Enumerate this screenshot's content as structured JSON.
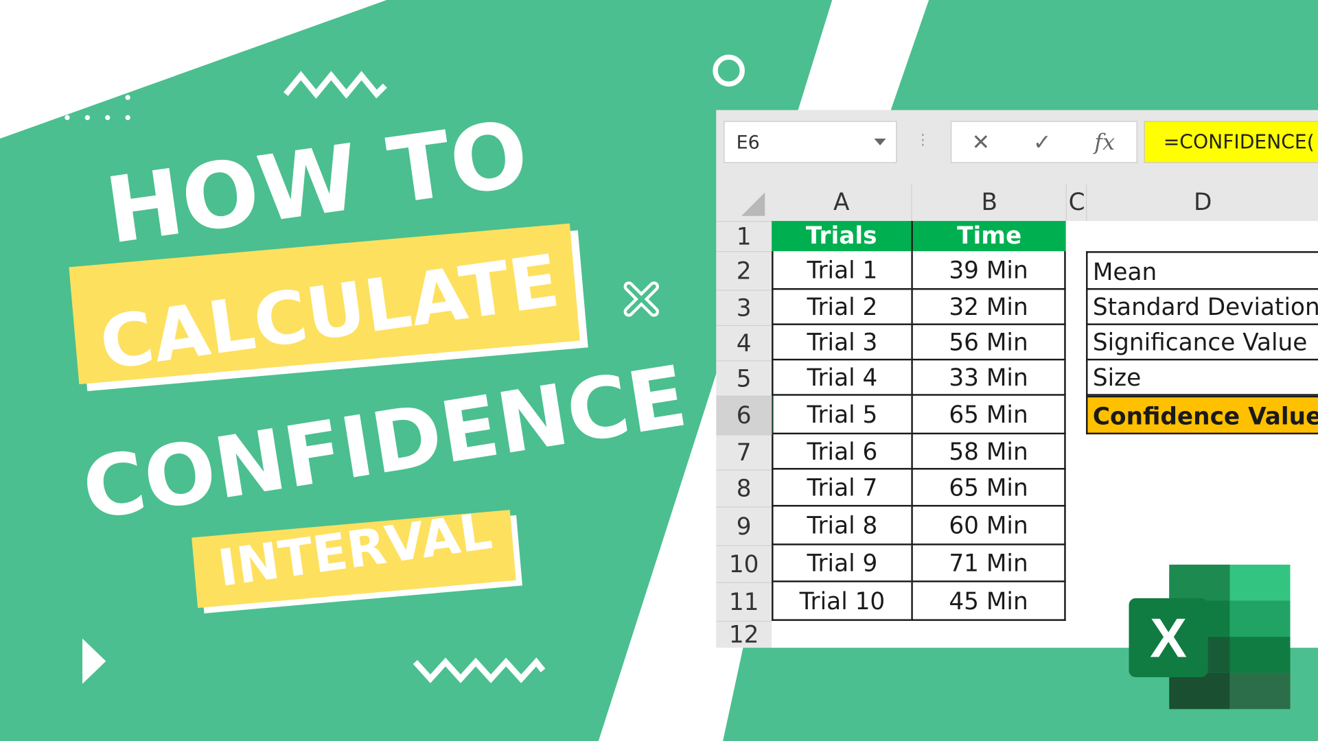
{
  "headline": {
    "line1": "HOW TO",
    "line2": "CALCULATE",
    "line3": "CONFIDENCE",
    "line4": "INTERVAL"
  },
  "colors": {
    "background_green": "#4bbf8f",
    "highlight_yellow": "#fde05e",
    "table_header_green": "#00b050",
    "confidence_orange": "#ffc000",
    "formula_yellow": "#ffff00"
  },
  "spreadsheet": {
    "name_box": "E6",
    "cancel_icon": "✕",
    "enter_icon": "✓",
    "fx_label": "fx",
    "formula": "=CONFIDENCE(",
    "columns": [
      "A",
      "B",
      "C",
      "D"
    ],
    "row_numbers": [
      "1",
      "2",
      "3",
      "4",
      "5",
      "6",
      "7",
      "8",
      "9",
      "10",
      "11",
      "12"
    ],
    "table_headers": [
      "Trials",
      "Time"
    ],
    "trials": [
      {
        "trial": "Trial 1",
        "time": "39 Min"
      },
      {
        "trial": "Trial 2",
        "time": "32 Min"
      },
      {
        "trial": "Trial 3",
        "time": "56 Min"
      },
      {
        "trial": "Trial 4",
        "time": "33 Min"
      },
      {
        "trial": "Trial 5",
        "time": "65 Min"
      },
      {
        "trial": "Trial 6",
        "time": "58 Min"
      },
      {
        "trial": "Trial 7",
        "time": "65 Min"
      },
      {
        "trial": "Trial 8",
        "time": "60 Min"
      },
      {
        "trial": "Trial 9",
        "time": "71 Min"
      },
      {
        "trial": "Trial 10",
        "time": "45 Min"
      }
    ],
    "stats_labels": [
      "Mean",
      "Standard Deviation",
      "Significance Value",
      "Size",
      "Confidence Value"
    ]
  },
  "excel_logo_letter": "X"
}
